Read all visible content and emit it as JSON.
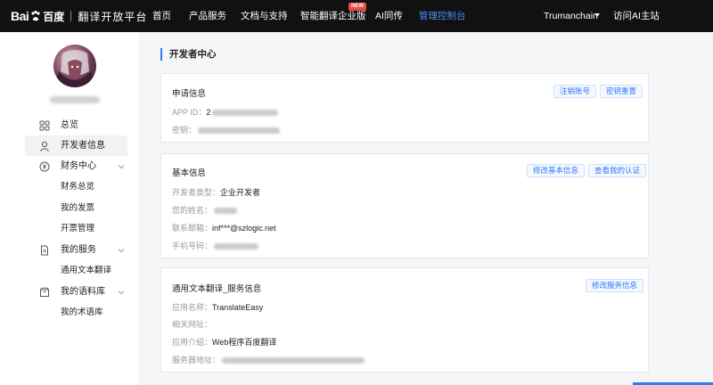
{
  "topnav": {
    "logo_bai": "Bai",
    "logo_du": "百度",
    "platform": "翻译开放平台",
    "items": [
      {
        "label": "首页"
      },
      {
        "label": "产品服务"
      },
      {
        "label": "文档与支持"
      },
      {
        "label": "智能翻译企业版"
      },
      {
        "label": "AI同传"
      },
      {
        "label": "管理控制台"
      }
    ],
    "new_badge": "NEW",
    "username": "Trumanchain",
    "visit_ai": "访问AI主站"
  },
  "sidebar": {
    "items": [
      {
        "label": "总览",
        "icon": "grid-icon"
      },
      {
        "label": "开发者信息",
        "icon": "user-icon"
      },
      {
        "label": "财务中心",
        "icon": "yen-circle-icon",
        "sub": [
          "财务总览",
          "我的发票",
          "开票管理"
        ]
      },
      {
        "label": "我的服务",
        "icon": "document-icon",
        "sub": [
          "通用文本翻译"
        ]
      },
      {
        "label": "我的语料库",
        "icon": "box-icon",
        "sub": [
          "我的术语库"
        ]
      }
    ]
  },
  "main": {
    "section_title": "开发者中心",
    "application": {
      "title": "申请信息",
      "btn_cancel": "注销账号",
      "btn_reset": "密钥重置",
      "appid_label": "APP ID：",
      "appid_value": "2",
      "key_label": "密钥："
    },
    "basic": {
      "title": "基本信息",
      "btn_edit": "修改基本信息",
      "btn_verify": "查看我的认证",
      "type_label": "开发者类型：",
      "type_value": "企业开发者",
      "name_label": "您的姓名：",
      "email_label": "联系邮箱：",
      "email_value": "inf***@szlogic.net",
      "phone_label": "手机号码："
    },
    "service": {
      "title": "通用文本翻译_服务信息",
      "btn_edit": "修改服务信息",
      "appname_label": "应用名称：",
      "appname_value": "TranslateEasy",
      "site_label": "相关网址：",
      "intro_label": "应用介绍：",
      "intro_value": "Web程序百度翻译",
      "server_label": "服务器地址："
    }
  },
  "colors": {
    "accent": "#2e7cf6",
    "nav_bg": "#111111",
    "active_nav": "#4e8ef7",
    "badge": "#e84a3d"
  }
}
